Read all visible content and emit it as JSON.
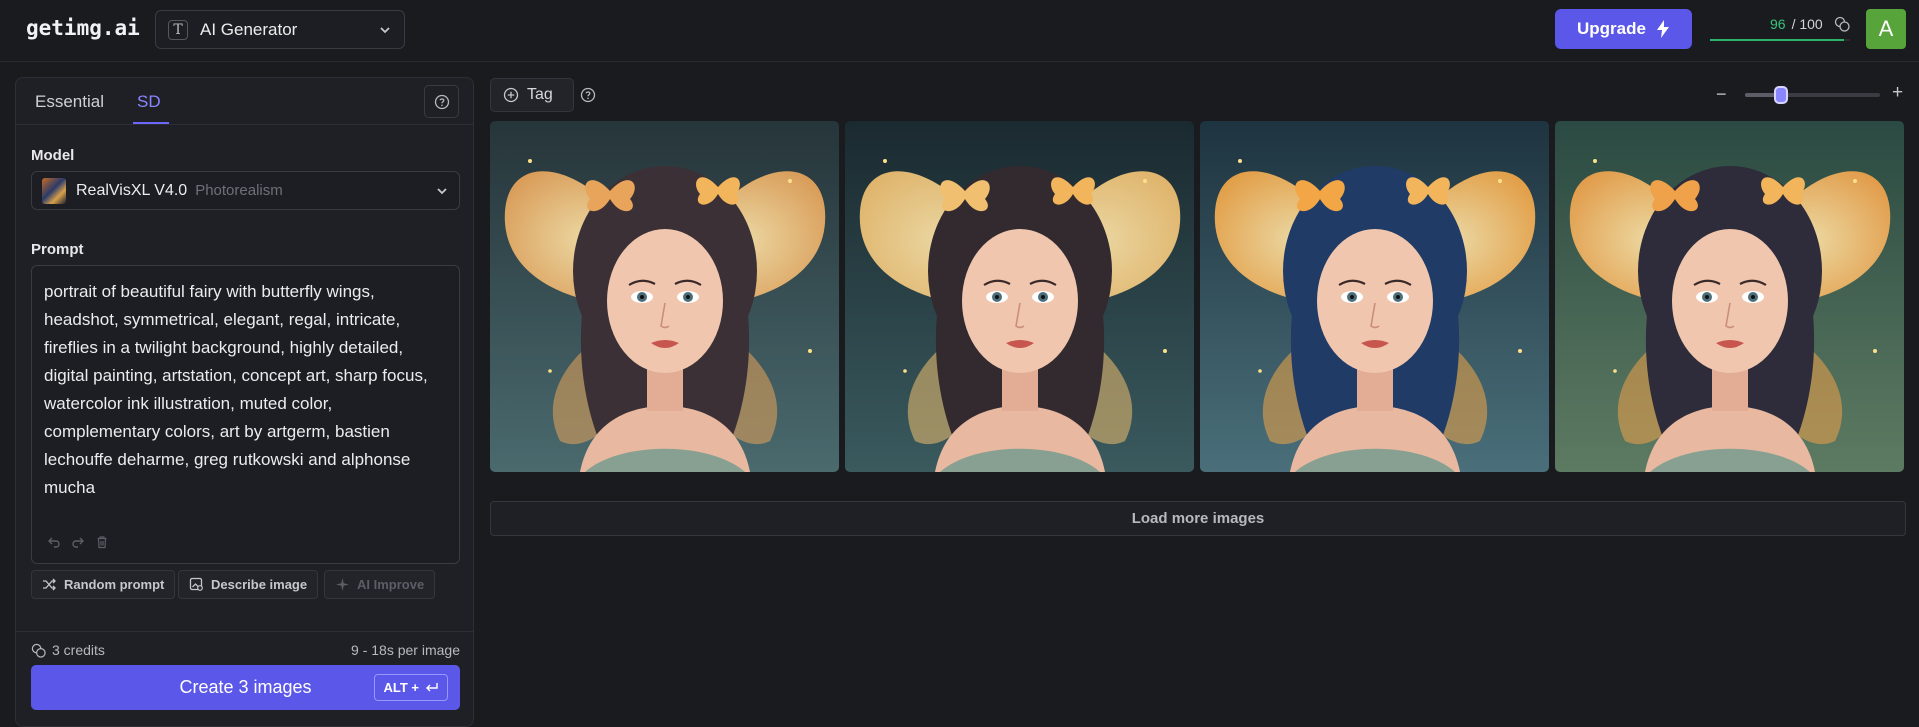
{
  "app": {
    "logo": "getimg.ai",
    "generator_select": {
      "label": "AI Generator",
      "icon": "text-t-icon"
    },
    "upgrade": {
      "label": "Upgrade",
      "icon": "lightning-icon",
      "color": "#5b57e8"
    },
    "credits": {
      "used": "96",
      "total": "/ 100",
      "fraction": 0.96
    },
    "avatar": {
      "initial": "A",
      "color": "#57a43a"
    }
  },
  "panel": {
    "tabs": [
      {
        "label": "Essential",
        "active": false
      },
      {
        "label": "SD",
        "active": true
      }
    ],
    "model": {
      "label": "Model",
      "name": "RealVisXL V4.0",
      "tag": "Photorealism"
    },
    "prompt": {
      "label": "Prompt",
      "text": "portrait of beautiful fairy with butterfly wings, headshot, symmetrical, elegant, regal, intricate, fireflies in a twilight background, highly detailed, digital painting, artstation, concept art, sharp focus, watercolor ink illustration, muted color, complementary colors, art by artgerm, bastien lechouffe deharme, greg rutkowski and alphonse mucha"
    },
    "actions": {
      "random": "Random prompt",
      "describe": "Describe image",
      "improve": "AI Improve"
    },
    "footer": {
      "cost": "3 credits",
      "time": "9 - 18s per image",
      "create": "Create 3 images",
      "shortcut": "ALT +"
    }
  },
  "main": {
    "tag_label": "Tag",
    "zoom_level": 0.27,
    "images": [
      {
        "name": "fairy-image-1",
        "bg_top": "#26353a",
        "bg_bottom": "#4a6a6e",
        "wing": "#e8a45a",
        "hair": "#3a3036"
      },
      {
        "name": "fairy-image-2",
        "bg_top": "#1a2a30",
        "bg_bottom": "#3a5a5e",
        "wing": "#f0bf70",
        "hair": "#332a30"
      },
      {
        "name": "fairy-image-3",
        "bg_top": "#1e3440",
        "bg_bottom": "#4a6f7a",
        "wing": "#f2a646",
        "hair": "#1f3b66"
      },
      {
        "name": "fairy-image-4",
        "bg_top": "#2b4a42",
        "bg_bottom": "#5d7b62",
        "wing": "#f0a24a",
        "hair": "#2e2c3a"
      }
    ],
    "load_more": "Load more images"
  }
}
